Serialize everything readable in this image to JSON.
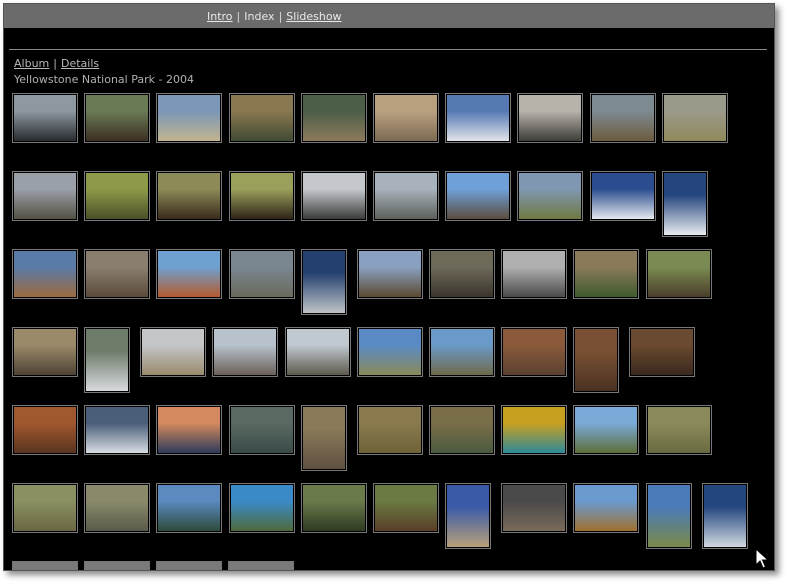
{
  "nav": {
    "intro": "Intro",
    "index": "Index",
    "slideshow": "Slideshow",
    "sep": "|"
  },
  "subnav": {
    "album": "Album",
    "details": "Details",
    "sep": "|"
  },
  "album": {
    "title": "Yellowstone National Park - 2004"
  },
  "thumbnails": [
    {
      "s": "l",
      "c": [
        "#8e98a0",
        "#262a2e"
      ]
    },
    {
      "s": "l",
      "c": [
        "#6a7a55",
        "#3b2e22"
      ]
    },
    {
      "s": "l",
      "c": [
        "#7c97b8",
        "#c2b48e"
      ]
    },
    {
      "s": "l",
      "c": [
        "#8a7850",
        "#3f4a33"
      ]
    },
    {
      "s": "l",
      "c": [
        "#4d5e48",
        "#8c7a5a"
      ]
    },
    {
      "s": "l",
      "c": [
        "#b9a180",
        "#7c6a52"
      ]
    },
    {
      "s": "l",
      "c": [
        "#5479b3",
        "#e2e4ea"
      ]
    },
    {
      "s": "l",
      "c": [
        "#b7b2aa",
        "#3e3d38"
      ]
    },
    {
      "s": "l",
      "c": [
        "#7e8a92",
        "#6c5b3e"
      ]
    },
    {
      "s": "l",
      "c": [
        "#9b998a",
        "#8f8a5a"
      ]
    },
    {
      "s": "l",
      "c": [
        "#9aa0a8",
        "#545044"
      ]
    },
    {
      "s": "l",
      "c": [
        "#8e9a48",
        "#4b4f28"
      ]
    },
    {
      "s": "l",
      "c": [
        "#8c8a56",
        "#3a2a1c"
      ]
    },
    {
      "s": "l",
      "c": [
        "#9aa05a",
        "#2e2418"
      ]
    },
    {
      "s": "l",
      "c": [
        "#c4c8cc",
        "#3b3b3a"
      ]
    },
    {
      "s": "l",
      "c": [
        "#a8b2bc",
        "#5d605a"
      ]
    },
    {
      "s": "l",
      "c": [
        "#6fa0d8",
        "#5b4d3e"
      ]
    },
    {
      "s": "l",
      "c": [
        "#7f97b0",
        "#6f7a42"
      ]
    },
    {
      "s": "l",
      "c": [
        "#2b4c8e",
        "#e4e8ee"
      ]
    },
    {
      "s": "p",
      "c": [
        "#24457e",
        "#e8ecf0"
      ]
    },
    {
      "s": "l",
      "c": [
        "#5a7aa8",
        "#9c6a3e"
      ]
    },
    {
      "s": "l",
      "c": [
        "#8a7e6e",
        "#5a4a3a"
      ]
    },
    {
      "s": "l",
      "c": [
        "#6ea0d0",
        "#b65a2e"
      ]
    },
    {
      "s": "l",
      "c": [
        "#7a8690",
        "#6a6a5c"
      ]
    },
    {
      "s": "p",
      "c": [
        "#24406e",
        "#bfc4c8"
      ]
    },
    {
      "s": "l",
      "c": [
        "#8aa0c0",
        "#5b4a32"
      ]
    },
    {
      "s": "l",
      "c": [
        "#6e6a5a",
        "#3a342c"
      ]
    },
    {
      "s": "l",
      "c": [
        "#b0b0b0",
        "#4a4a4a"
      ]
    },
    {
      "s": "l",
      "c": [
        "#8a7a5a",
        "#3e5a2e"
      ]
    },
    {
      "s": "l",
      "c": [
        "#7a8a52",
        "#4a3e2a"
      ]
    },
    {
      "s": "l",
      "c": [
        "#9a8a6a",
        "#4e4234"
      ]
    },
    {
      "s": "p",
      "c": [
        "#6e7c6a",
        "#d8dade"
      ]
    },
    {
      "s": "l",
      "c": [
        "#c4c6c8",
        "#9a8a6a"
      ]
    },
    {
      "s": "l",
      "c": [
        "#b8c2cc",
        "#6a6058"
      ]
    },
    {
      "s": "l",
      "c": [
        "#c0c8d0",
        "#5e5a4e"
      ]
    },
    {
      "s": "l",
      "c": [
        "#5a8ac4",
        "#8a8a5a"
      ]
    },
    {
      "s": "l",
      "c": [
        "#6a9ac8",
        "#6e6a4a"
      ]
    },
    {
      "s": "l",
      "c": [
        "#8a5a3a",
        "#5a4030"
      ]
    },
    {
      "s": "p",
      "c": [
        "#7a5034",
        "#4a3222"
      ]
    },
    {
      "s": "l",
      "c": [
        "#6a4a30",
        "#3a281e"
      ]
    },
    {
      "s": "l",
      "c": [
        "#a0582e",
        "#5a3420"
      ]
    },
    {
      "s": "l",
      "c": [
        "#4a5e7a",
        "#d6dce2"
      ]
    },
    {
      "s": "l",
      "c": [
        "#d48a5e",
        "#2e3a5a"
      ]
    },
    {
      "s": "l",
      "c": [
        "#5a6a62",
        "#3a4a48"
      ]
    },
    {
      "s": "p",
      "c": [
        "#8a7a5a",
        "#5e5040"
      ]
    },
    {
      "s": "l",
      "c": [
        "#8a7a4e",
        "#6e6238"
      ]
    },
    {
      "s": "l",
      "c": [
        "#7a6e4a",
        "#4a5a3e"
      ]
    },
    {
      "s": "l",
      "c": [
        "#c8a020",
        "#2e8a9a"
      ]
    },
    {
      "s": "l",
      "c": [
        "#7aaad8",
        "#5e6e3a"
      ]
    },
    {
      "s": "l",
      "c": [
        "#8a8a5a",
        "#6a6a42"
      ]
    },
    {
      "s": "l",
      "c": [
        "#8a9062",
        "#6a6644"
      ]
    },
    {
      "s": "l",
      "c": [
        "#8a8a6a",
        "#5a5a4a"
      ]
    },
    {
      "s": "l",
      "c": [
        "#5a8ac0",
        "#2e4a3a"
      ]
    },
    {
      "s": "l",
      "c": [
        "#3a8ac8",
        "#4e6a3a"
      ]
    },
    {
      "s": "l",
      "c": [
        "#6a7a4a",
        "#2e3a22"
      ]
    },
    {
      "s": "l",
      "c": [
        "#6a7a42",
        "#5a3e28"
      ]
    },
    {
      "s": "p",
      "c": [
        "#3a5aa8",
        "#b8a07a"
      ]
    },
    {
      "s": "l",
      "c": [
        "#4a4a4a",
        "#7a6a5a"
      ]
    },
    {
      "s": "l",
      "c": [
        "#6a9ad0",
        "#a0702e"
      ]
    },
    {
      "s": "p",
      "c": [
        "#4a7ab8",
        "#7a8a4a"
      ]
    },
    {
      "s": "p",
      "c": [
        "#24467e",
        "#d0d8e0"
      ]
    }
  ]
}
